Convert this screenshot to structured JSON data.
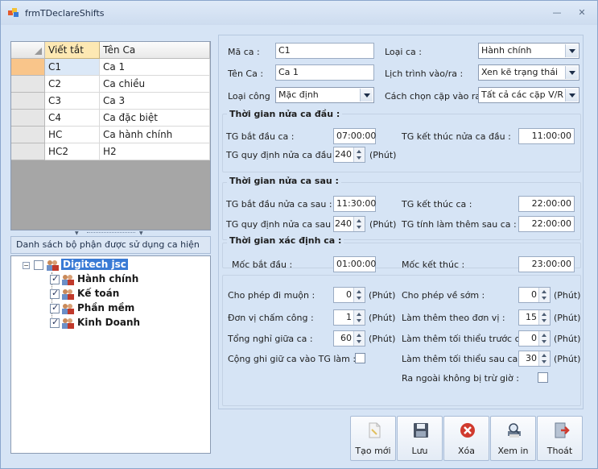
{
  "window": {
    "title": "frmTDeclareShifts"
  },
  "grid": {
    "columns": [
      "Viết tắt",
      "Tên Ca"
    ],
    "rows": [
      [
        "C1",
        "Ca 1"
      ],
      [
        "C2",
        "Ca chiều"
      ],
      [
        "C3",
        "Ca 3"
      ],
      [
        "C4",
        "Ca đặc biệt"
      ],
      [
        "HC",
        "Ca hành chính"
      ],
      [
        "HC2",
        "H2"
      ]
    ]
  },
  "tree": {
    "header": "Danh sách bộ phận được sử dụng ca hiện tại",
    "root": "Digitech jsc",
    "children": [
      "Hành chính",
      "Kế toán",
      "Phần mềm",
      "Kinh Doanh"
    ]
  },
  "form": {
    "ma_ca_label": "Mã ca :",
    "ma_ca_value": "C1",
    "ten_ca_label": "Tên Ca :",
    "ten_ca_value": "Ca 1",
    "loai_cong_label": "Loại công",
    "loai_cong_value": "Mặc định",
    "loai_ca_label": "Loại ca :",
    "loai_ca_value": "Hành chính",
    "lich_trinh_label": "Lịch trình vào/ra :",
    "lich_trinh_value": "Xen kẽ trạng thái",
    "cach_chon_label": "Cách chọn cặp vào ra",
    "cach_chon_value": "Tất cả các cặp V/R"
  },
  "first_half": {
    "title": "Thời gian nửa ca đầu :",
    "start_label": "TG bắt đầu ca :",
    "start_value": "07:00:00",
    "end_label": "TG kết thúc nửa ca đầu :",
    "end_value": "11:00:00",
    "duration_label": "TG quy định nửa ca đầu :",
    "duration_value": "240",
    "unit": "(Phút)"
  },
  "second_half": {
    "title": "Thời gian nửa ca sau :",
    "start_label": "TG bắt đầu nửa ca sau :",
    "start_value": "11:30:00",
    "end_label": "TG kết thúc ca :",
    "end_value": "22:00:00",
    "duration_label": "TG quy định nửa ca sau :",
    "duration_value": "240",
    "unit": "(Phút)",
    "overtime_label": "TG tính làm thêm sau ca :",
    "overtime_value": "22:00:00"
  },
  "identify": {
    "title": "Thời gian xác định ca :",
    "start_label": "Mốc bắt đầu :",
    "start_value": "01:00:00",
    "end_label": "Mốc kết thúc :",
    "end_value": "23:00:00"
  },
  "options": {
    "late_label": "Cho phép đi muộn :",
    "late_value": "0",
    "early_label": "Cho phép về sớm :",
    "early_value": "0",
    "unit_label": "Đơn vị chấm công :",
    "unit_value": "1",
    "ot_unit_label": "Làm thêm theo đơn vị :",
    "ot_unit_value": "15",
    "break_label": "Tổng nghỉ giữa ca :",
    "break_value": "60",
    "ot_before_label": "Làm thêm tối thiểu trước ca :",
    "ot_before_value": "0",
    "add_break_label": "Cộng ghi giữ ca vào TG làm :",
    "ot_after_label": "Làm thêm tối thiểu sau ca :",
    "ot_after_value": "30",
    "out_label": "Ra ngoài không bị trừ giờ :",
    "unit_text": "(Phút)"
  },
  "buttons": {
    "new": "Tạo mới",
    "save": "Lưu",
    "delete": "Xóa",
    "preview": "Xem in",
    "exit": "Thoát"
  }
}
